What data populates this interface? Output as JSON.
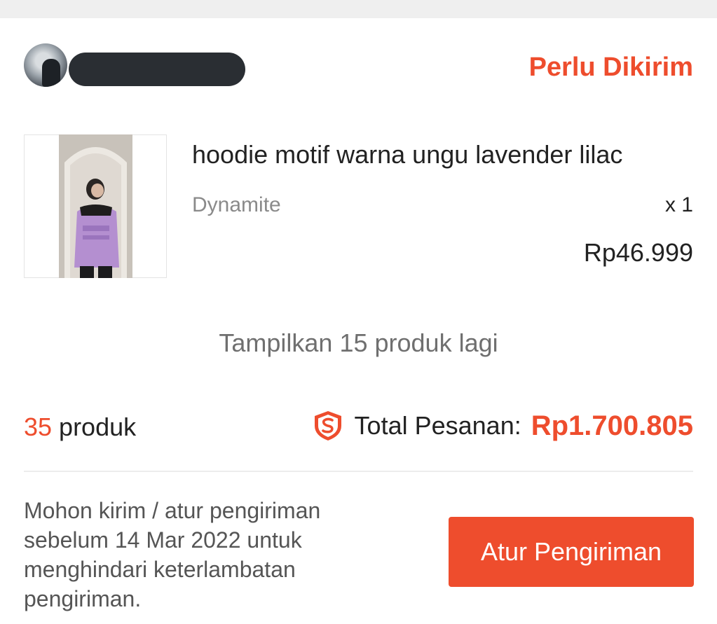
{
  "order": {
    "status": "Perlu Dikirim"
  },
  "product": {
    "name": "hoodie motif warna ungu lavender lilac",
    "variant": "Dynamite",
    "quantity": "x 1",
    "price": "Rp46.999"
  },
  "show_more_label": "Tampilkan 15 produk lagi",
  "summary": {
    "count_number": "35",
    "count_label": "produk",
    "total_label": "Total Pesanan:",
    "total_value": "Rp1.700.805"
  },
  "notice": "Mohon kirim / atur pengiriman sebelum 14 Mar 2022 untuk menghindari keterlambatan pengiriman.",
  "action_button_label": "Atur Pengiriman",
  "icons": {
    "shield": "shopee-guarantee-shield-icon"
  },
  "colors": {
    "accent": "#ee4d2d"
  }
}
